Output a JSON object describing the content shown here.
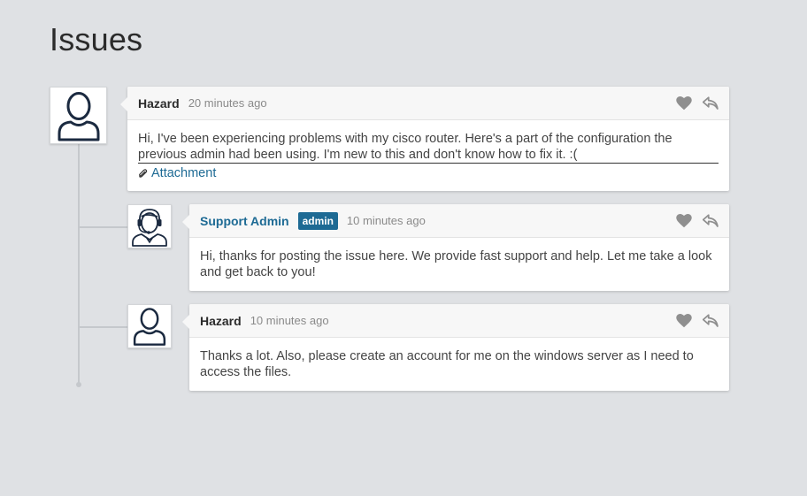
{
  "page": {
    "title": "Issues"
  },
  "comments": [
    {
      "author": "Hazard",
      "time": "20 minutes ago",
      "body": "Hi, I've been experiencing problems with my cisco router. Here's a part of the configuration the previous admin had been using. I'm new to this and don't know how to fix it. :(",
      "attachment_label": "Attachment",
      "avatar_icon": "user-outline-icon"
    },
    {
      "author": "Support Admin",
      "badge": "admin",
      "time": "10 minutes ago",
      "body": "Hi, thanks for posting the issue here. We provide fast support and help. Let me take a look and get back to you!",
      "avatar_icon": "support-agent-headset-icon"
    },
    {
      "author": "Hazard",
      "time": "10 minutes ago",
      "body": "Thanks a lot. Also, please create an account for me on the windows server as I need to access the files.",
      "avatar_icon": "user-outline-icon"
    }
  ],
  "colors": {
    "background": "#dfe1e4",
    "accent": "#1d6a94",
    "icon_gray": "#8f8f8f"
  }
}
